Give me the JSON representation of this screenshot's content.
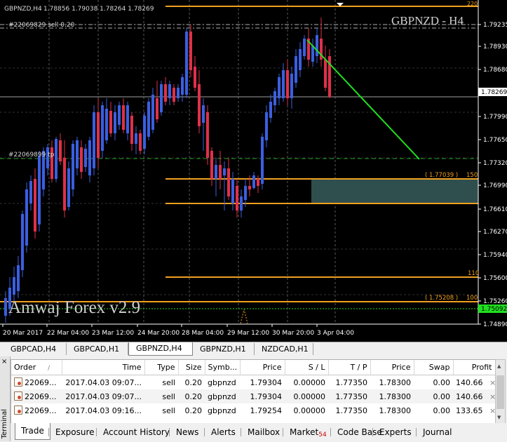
{
  "chart": {
    "header_symbol": "GBPNZD,H4",
    "header_ohlc": "1.78856 1.79038 1.78264 1.78269",
    "title": "GBPNZD - H4",
    "watermark": "Amwaj Forex v2.9",
    "order_label_sell": "#22069829 sell 0.20",
    "order_label_tp": "#22069899 tp",
    "price_ticks": [
      "1.79235",
      "1.78930",
      "1.78680",
      "1.78269",
      "1.77990",
      "1.77650",
      "1.77320",
      "1.76990",
      "1.76610",
      "1.76270",
      "1.75940",
      "1.75600",
      "1.75260",
      "1.75092",
      "1.74890"
    ],
    "current_price": "1.78269",
    "bid_price": "1.75092",
    "time_labels": [
      "20 Mar 2017",
      "22 Mar 04:00",
      "23 Mar 12:00",
      "24 Mar 20:00",
      "28 Mar 04:00",
      "29 Mar 12:00",
      "30 Mar 20:00",
      "3 Apr 04:00"
    ],
    "level_top": "220",
    "level_150_price": "( 1.77039 )",
    "level_150": "150",
    "level_110": "110",
    "level_100_price": "( 1.75208 )",
    "level_100": "100",
    "colors": {
      "bull": "#3a5fe0",
      "bear": "#e0304a",
      "level": "#f0a020",
      "trend": "#20e020",
      "zone": "#2f4f4f",
      "tp": "#20a020"
    }
  },
  "chart_tabs": [
    "GBPCAD,H4",
    "GBPCAD,H1",
    "GBPNZD,H4",
    "GBPNZD,H1",
    "NZDCAD,H1"
  ],
  "active_chart_tab": 2,
  "terminal": {
    "side_label": "Terminal",
    "close_icon": "×",
    "columns": [
      "Order",
      "Time",
      "Type",
      "Size",
      "Symb...",
      "Price",
      "S / L",
      "T / P",
      "Price",
      "Swap",
      "Profit"
    ],
    "sort_indicator": "/",
    "rows": [
      [
        "22069...",
        "2017.04.03 09:07...",
        "sell",
        "0.20",
        "gbpnzd",
        "1.79304",
        "0.00000",
        "1.77350",
        "1.78300",
        "0.00",
        "140.66"
      ],
      [
        "22069...",
        "2017.04.03 09:07...",
        "sell",
        "0.20",
        "gbpnzd",
        "1.79304",
        "0.00000",
        "1.77350",
        "1.78300",
        "0.00",
        "140.66"
      ],
      [
        "22069...",
        "2017.04.03 09:16...",
        "sell",
        "0.20",
        "gbpnzd",
        "1.79254",
        "0.00000",
        "1.77350",
        "1.78300",
        "0.00",
        "133.65"
      ]
    ],
    "row_delete": "×"
  },
  "bottom_tabs": [
    {
      "label": "Trade"
    },
    {
      "label": "Exposure"
    },
    {
      "label": "Account History"
    },
    {
      "label": "News"
    },
    {
      "label": "Alerts"
    },
    {
      "label": "Mailbox"
    },
    {
      "label": "Market",
      "badge": "54"
    },
    {
      "label": "Code Base"
    },
    {
      "label": "Experts"
    },
    {
      "label": "Journal"
    }
  ]
}
